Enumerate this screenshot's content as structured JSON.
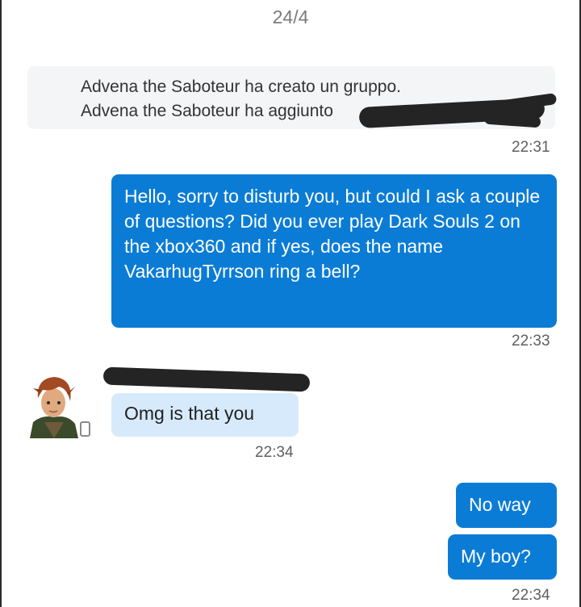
{
  "date_header": "24/4",
  "system_message": {
    "line1": "Advena the Saboteur ha creato un gruppo.",
    "line2": "Advena the Saboteur ha aggiunto"
  },
  "messages": [
    {
      "time_label": "22:31"
    },
    {
      "text": "Hello, sorry to disturb you, but could I ask a couple of questions? Did you ever play Dark Souls 2 on the xbox360 and if yes, does the name VakarhugTyrrson ring a bell?",
      "time": "22:33"
    },
    {
      "text": "Omg is that you",
      "time": "22:34"
    },
    {
      "text": "No way"
    },
    {
      "text": "My boy?",
      "time": "22:34"
    }
  ],
  "colors": {
    "outgoing": "#0a7cd6",
    "incoming": "#d7eafb",
    "redaction": "#242424"
  }
}
